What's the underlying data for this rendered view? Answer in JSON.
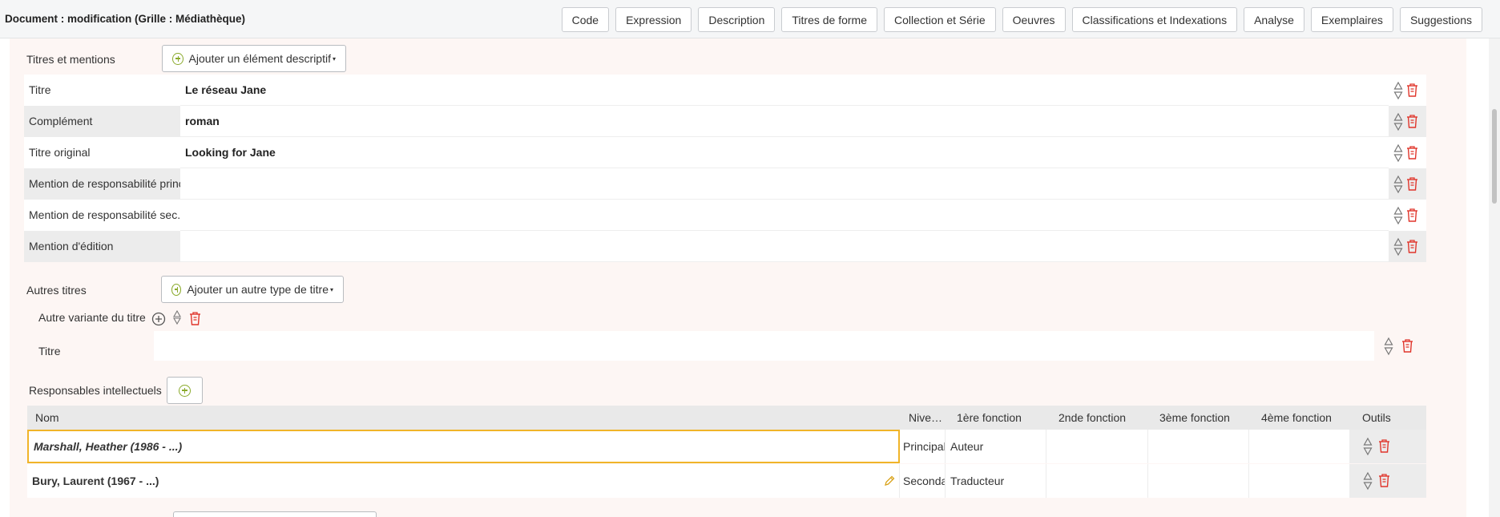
{
  "header": {
    "title": "Document : modification (Grille : Médiathèque)",
    "tabs": [
      "Code",
      "Expression",
      "Description",
      "Titres de forme",
      "Collection et Série",
      "Oeuvres",
      "Classifications et Indexations",
      "Analyse",
      "Exemplaires",
      "Suggestions"
    ]
  },
  "titles_section": {
    "label": "Titres et mentions",
    "add_button": "Ajouter un élément descriptif",
    "rows": [
      {
        "label": "Titre",
        "value": "Le réseau Jane"
      },
      {
        "label": "Complément",
        "value": "roman"
      },
      {
        "label": "Titre original",
        "value": "Looking for Jane"
      },
      {
        "label": "Mention de responsabilité principale",
        "value": ""
      },
      {
        "label": "Mention de responsabilité sec.",
        "value": ""
      },
      {
        "label": "Mention d'édition",
        "value": ""
      }
    ]
  },
  "other_titles": {
    "label": "Autres titres",
    "add_button": "Ajouter un autre type de titre",
    "variant_label": "Autre variante du titre",
    "field_label": "Titre",
    "field_value": ""
  },
  "responsibles": {
    "label": "Responsables intellectuels",
    "columns": [
      "Nom",
      "Nive…",
      "1ère fonction",
      "2nde fonction",
      "3ème fonction",
      "4ème fonction",
      "Outils"
    ],
    "rows": [
      {
        "name": "Marshall, Heather (1986 - ...)",
        "level": "Principal",
        "f1": "Auteur",
        "f2": "",
        "f3": "",
        "f4": "",
        "selected": true
      },
      {
        "name": "Bury, Laurent (1967 - ...)",
        "level": "Seconda",
        "f1": "Traducteur",
        "f2": "",
        "f3": "",
        "f4": "",
        "selected": false
      }
    ]
  },
  "colors": {
    "accent_green": "#8aaa2c",
    "delete_red": "#e0352b",
    "selected_border": "#f0b429"
  }
}
